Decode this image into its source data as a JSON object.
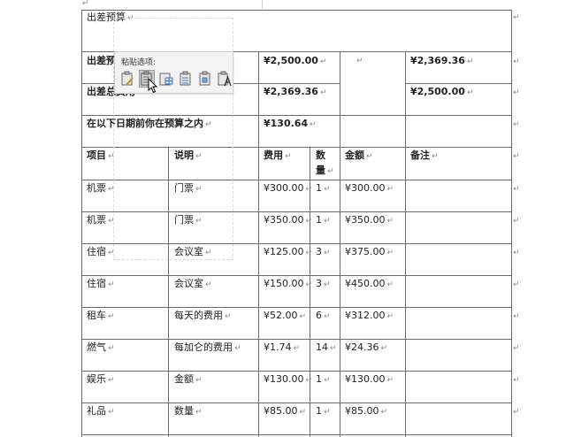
{
  "para_mark": "↵",
  "cell_mark": "↵",
  "title": "出差预算",
  "summary": [
    {
      "label": "出差预算",
      "amount": "¥2,500.00",
      "right": "¥2,369.36"
    },
    {
      "label": "出差总费用",
      "amount": "¥2,369.36",
      "right": "¥2,500.00"
    },
    {
      "label": "在以下日期前你在预算之内",
      "amount": "¥130.64",
      "right": ""
    }
  ],
  "headers": {
    "item": "项目",
    "desc": "说明",
    "cost": "费用",
    "qty": "数量",
    "qty_line1": "数",
    "qty_line2": "量",
    "amount": "金额",
    "note": "备注"
  },
  "rows": [
    {
      "item": "机票",
      "desc": "门票",
      "cost": "¥300.00",
      "qty": "1",
      "amount": "¥300.00"
    },
    {
      "item": "机票",
      "desc": "门票",
      "cost": "¥350.00",
      "qty": "1",
      "amount": "¥350.00"
    },
    {
      "item": "住宿",
      "desc": "会议室",
      "cost": "¥125.00",
      "qty": "3",
      "amount": "¥375.00"
    },
    {
      "item": "住宿",
      "desc": "会议室",
      "cost": "¥150.00",
      "qty": "3",
      "amount": "¥450.00"
    },
    {
      "item": "租车",
      "desc": "每天的费用",
      "cost": "¥52.00",
      "qty": "6",
      "amount": "¥312.00"
    },
    {
      "item": "燃气",
      "desc": "每加仑的费用",
      "cost": "¥1.74",
      "qty": "14",
      "amount": "¥24.36"
    },
    {
      "item": "娱乐",
      "desc": "金额",
      "cost": "¥130.00",
      "qty": "1",
      "amount": "¥130.00"
    },
    {
      "item": "礼品",
      "desc": "数量",
      "cost": "¥85.00",
      "qty": "1",
      "amount": "¥85.00"
    }
  ],
  "paste_popup": {
    "title": "粘贴选项:",
    "icons": [
      "keep-source-formatting-icon",
      "merge-formatting-icon",
      "nest-table-icon",
      "insert-as-new-rows-icon",
      "overwrite-cells-icon",
      "keep-text-only-icon"
    ]
  }
}
